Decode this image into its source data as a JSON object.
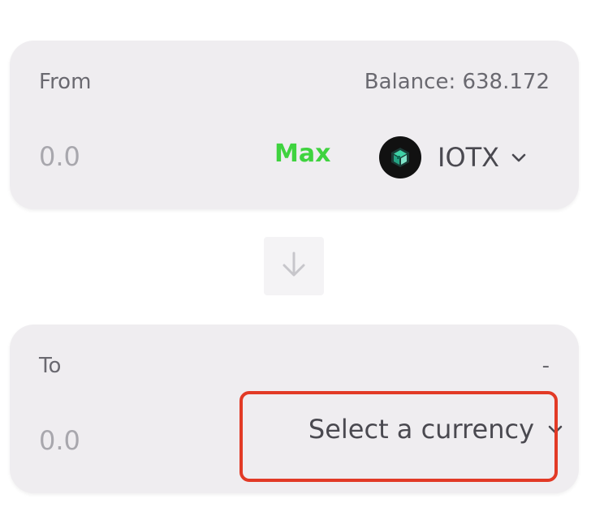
{
  "from_panel": {
    "label": "From",
    "balance": "Balance: 638.172",
    "amount_placeholder": "0.0",
    "max_label": "Max",
    "token": {
      "symbol": "IOTX",
      "icon": "iotx-logo-icon"
    }
  },
  "swap": {
    "icon": "arrow-down-icon"
  },
  "to_panel": {
    "label": "To",
    "balance": "-",
    "amount_placeholder": "0.0",
    "select_label": "Select a currency"
  },
  "colors": {
    "panel_bg": "#efedf0",
    "max_green": "#3fd33f",
    "highlight_red": "#e23a26",
    "text_primary": "#4a4950",
    "text_muted": "#a8a7ad"
  }
}
